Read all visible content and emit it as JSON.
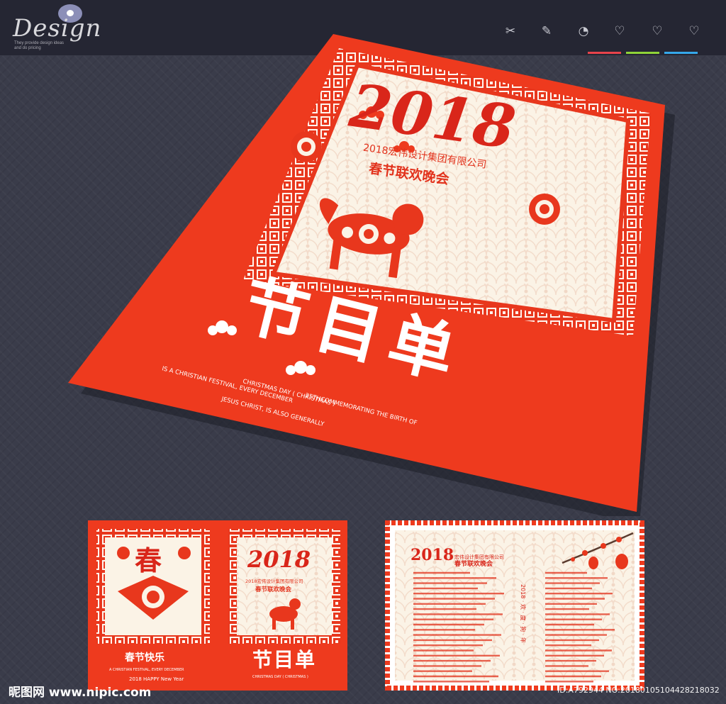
{
  "header": {
    "logo_text": "Design",
    "logo_tagline": "They provide design ideas and do pricing",
    "tools": [
      {
        "name": "scissors-icon",
        "glyph": "✂"
      },
      {
        "name": "pencil-icon",
        "glyph": "✎"
      },
      {
        "name": "clock-icon",
        "glyph": "◔"
      },
      {
        "name": "heart-icon",
        "glyph": "♡"
      },
      {
        "name": "heart-add-icon",
        "glyph": "♡"
      },
      {
        "name": "heart-remove-icon",
        "glyph": "♡"
      }
    ],
    "underline_colors": [
      "#e8434b",
      "#8fd438",
      "#35a8ea"
    ]
  },
  "poster": {
    "year": "2018",
    "company": "2018宏伟设计集团有限公司",
    "event": "春节联欢晚会",
    "headline": "节目单",
    "english_lines": [
      "IS A CHRISTIAN FESTIVAL, EVERY DECEMBER",
      "CHRISTMAS DAY ( CHRISTMAS )",
      "JESUS CHRIST, IS ALSO GENERALLY",
      "25THCOMMEMORATING THE BIRTH OF"
    ],
    "colors": {
      "red": "#ee3a1e",
      "cream": "#fbf3e6",
      "frame": "#e7361c"
    }
  },
  "thumb_left": {
    "back_title": "春节快乐",
    "back_en": "A CHRISTIAN FESTIVAL, EVERY DECEMBER",
    "back_footer": "2018 HAPPY New Year",
    "glyph": "春",
    "front_year": "2018",
    "front_company": "2018宏伟设计集团有限公司",
    "front_event": "春节联欢晚会",
    "front_headline": "节目单",
    "front_en": "CHRISTMAS DAY ( CHRISTMAS )"
  },
  "thumb_right": {
    "year": "2018",
    "company": "宏伟设计集团有限公司",
    "event": "春节联欢晚会",
    "side_text": "2018 · 欢 · 度 · 狗 · 年"
  },
  "footer": {
    "site": "昵图网 www.nipic.com",
    "id": "ID:A792944 NO:20180105104428218032"
  }
}
